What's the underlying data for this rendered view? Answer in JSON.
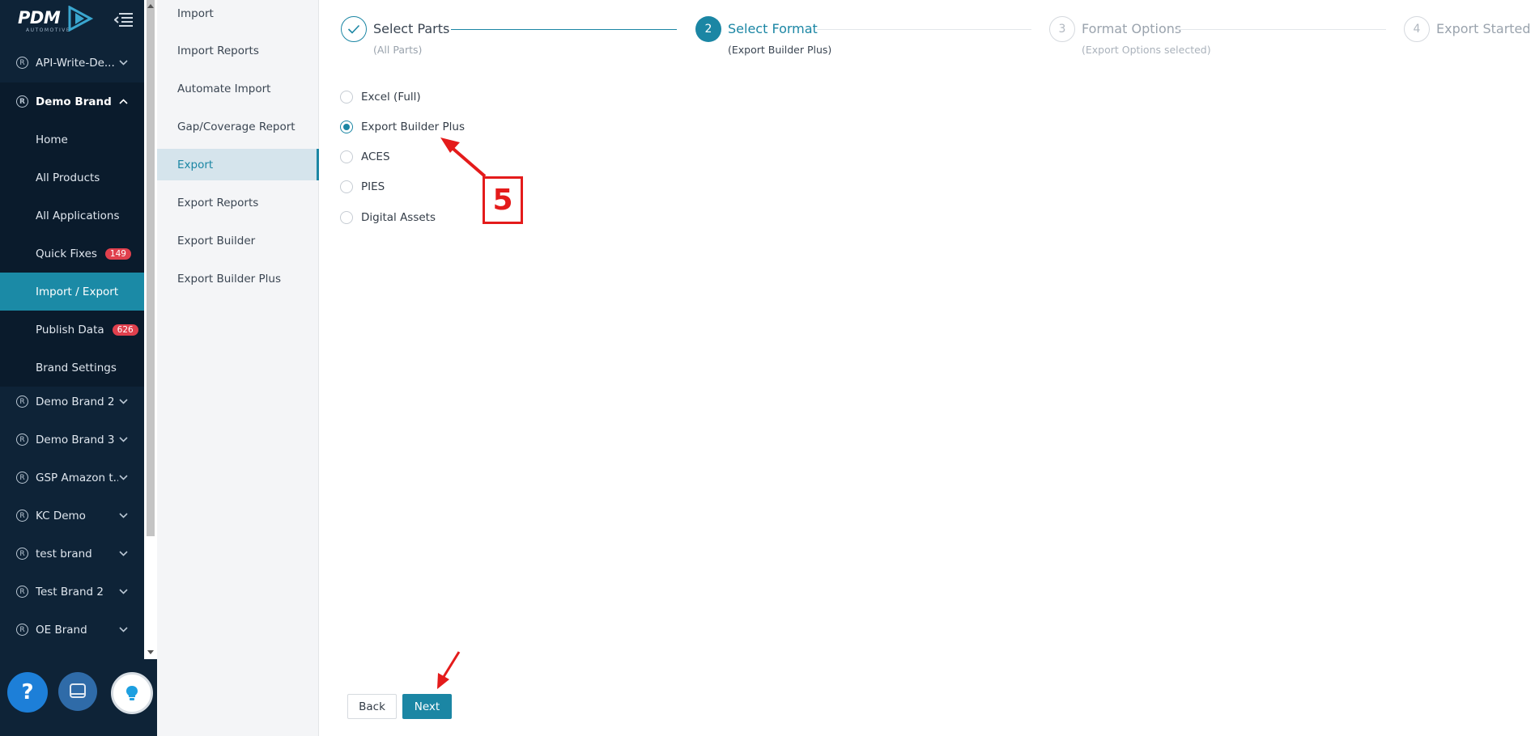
{
  "logo": {
    "text": "PDM",
    "subtext": "AUTOMOTIVE"
  },
  "sidebar": {
    "brands": [
      {
        "label": "API-Write-De...",
        "expanded": false
      },
      {
        "label": "Demo Brand",
        "expanded": true
      },
      {
        "label": "Demo Brand 2",
        "expanded": false
      },
      {
        "label": "Demo Brand 3",
        "expanded": false
      },
      {
        "label": "GSP Amazon t...",
        "expanded": false
      },
      {
        "label": "KC Demo",
        "expanded": false
      },
      {
        "label": "test brand",
        "expanded": false
      },
      {
        "label": "Test Brand 2",
        "expanded": false
      },
      {
        "label": "OE Brand",
        "expanded": false
      }
    ],
    "sub_items": [
      {
        "label": "Home"
      },
      {
        "label": "All Products"
      },
      {
        "label": "All Applications"
      },
      {
        "label": "Quick Fixes",
        "badge": "149"
      },
      {
        "label": "Import / Export",
        "active": true
      },
      {
        "label": "Publish Data",
        "badge": "626"
      },
      {
        "label": "Brand Settings"
      }
    ],
    "reg_symbol": "R"
  },
  "help": {
    "question_icon": "?"
  },
  "submenu": {
    "items": [
      {
        "label": "Import"
      },
      {
        "label": "Import Reports"
      },
      {
        "label": "Automate Import"
      },
      {
        "label": "Gap/Coverage Report"
      },
      {
        "label": "Export",
        "active": true
      },
      {
        "label": "Export Reports"
      },
      {
        "label": "Export Builder"
      },
      {
        "label": "Export Builder Plus"
      }
    ]
  },
  "steps": [
    {
      "number": "",
      "title": "Select Parts",
      "subtitle": "(All Parts)",
      "state": "done"
    },
    {
      "number": "2",
      "title": "Select Format",
      "subtitle": "(Export Builder Plus)",
      "state": "current"
    },
    {
      "number": "3",
      "title": "Format Options",
      "subtitle": "(Export Options selected)",
      "state": "pending"
    },
    {
      "number": "4",
      "title": "Export Started",
      "subtitle": "",
      "state": "pending"
    }
  ],
  "formats": {
    "options": [
      {
        "label": "Excel (Full)",
        "selected": false
      },
      {
        "label": "Export Builder Plus",
        "selected": true
      },
      {
        "label": "ACES",
        "selected": false
      },
      {
        "label": "PIES",
        "selected": false
      },
      {
        "label": "Digital Assets",
        "selected": false
      }
    ]
  },
  "buttons": {
    "back": "Back",
    "next": "Next"
  },
  "annotation": {
    "step_number": "5",
    "color": "#e41b1b"
  },
  "colors": {
    "sidebar_bg": "#0e2337",
    "accent": "#1b86a4",
    "badge": "#e0404d"
  }
}
